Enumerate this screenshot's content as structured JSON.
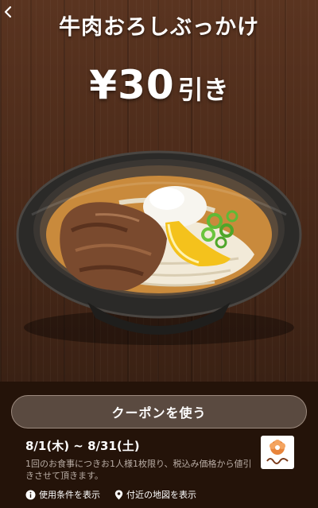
{
  "coupon": {
    "title": "牛肉おろしぶっかけ",
    "price_amount": "¥30",
    "price_suffix": "引き",
    "use_button_label": "クーポンを使う",
    "period": "8/1(木) ~ 8/31(土)",
    "note": "1回のお食事につきお1人様1枚限り、税込み価格から値引きさせて頂きます。",
    "terms_link_label": "使用条件を表示",
    "map_link_label": "付近の地図を表示"
  },
  "colors": {
    "button_bg": "#5a4a40",
    "bottom_bg": "#241309",
    "logo_accent": "#e8843a"
  }
}
